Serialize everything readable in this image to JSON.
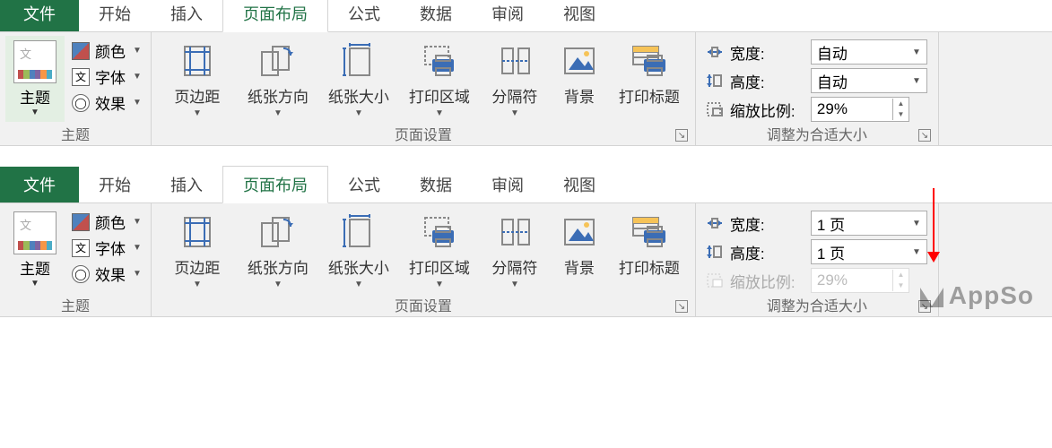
{
  "tabs": {
    "file": "文件",
    "home": "开始",
    "insert": "插入",
    "page_layout": "页面布局",
    "formulas": "公式",
    "data": "数据",
    "review": "审阅",
    "view": "视图"
  },
  "groups": {
    "themes": {
      "label": "主题",
      "main": "主题",
      "colors": "颜色",
      "fonts": "字体",
      "effects": "效果"
    },
    "page_setup": {
      "label": "页面设置",
      "margins": "页边距",
      "orientation": "纸张方向",
      "size": "纸张大小",
      "print_area": "打印区域",
      "breaks": "分隔符",
      "background": "背景",
      "print_titles": "打印标题"
    },
    "scale_to_fit": {
      "label": "调整为合适大小",
      "width": "宽度:",
      "height": "高度:",
      "scale": "缩放比例:"
    }
  },
  "before": {
    "width_value": "自动",
    "height_value": "自动",
    "scale_value": "29%"
  },
  "after": {
    "width_value": "1 页",
    "height_value": "1 页",
    "scale_value": "29%"
  },
  "watermark": "AppSo"
}
